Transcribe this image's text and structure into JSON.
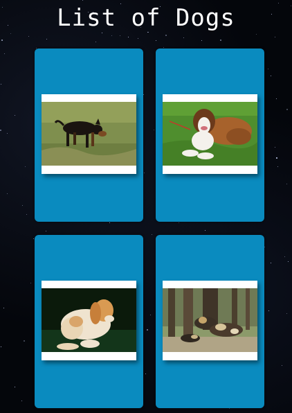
{
  "page": {
    "title": "List of Dogs"
  },
  "dogs": [
    {
      "image": "black-and-tan-dog-on-grass-photo"
    },
    {
      "image": "saint-bernard-lying-on-grass-photo"
    },
    {
      "image": "cocker-spaniel-on-dark-background-photo"
    },
    {
      "image": "african-wild-dogs-in-forest-photo"
    }
  ],
  "colors": {
    "background": "#04060b",
    "card": "#0a8bbf",
    "title": "#ffffff",
    "photo_border": "#ffffff"
  }
}
